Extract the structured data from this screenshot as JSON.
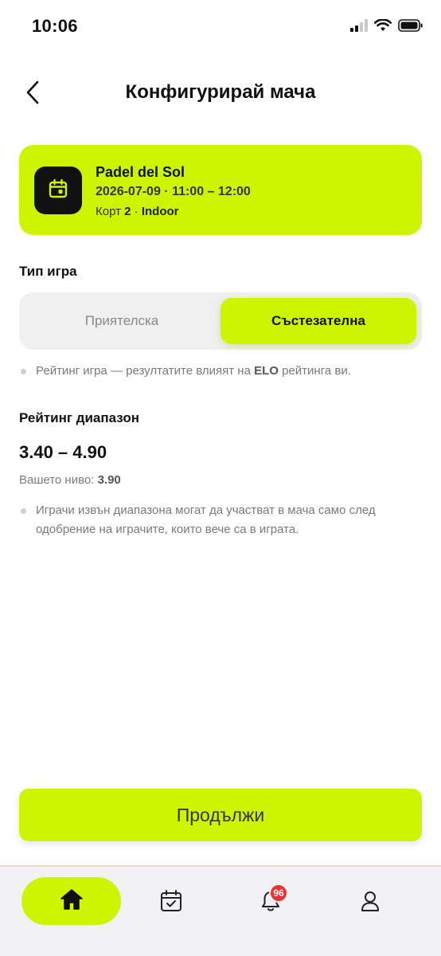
{
  "status_bar": {
    "time": "10:06"
  },
  "header": {
    "title": "Конфигурирай мача",
    "back_icon": "chevron-left-icon"
  },
  "booking": {
    "icon": "calendar-icon",
    "venue": "Padel del Sol",
    "datetime": "2026-07-09 · 11:00 – 12:00",
    "court_prefix": "Корт ",
    "court_number": "2",
    "court_sep": " · ",
    "court_type": "Indoor"
  },
  "game_type": {
    "label": "Тип игра",
    "options": [
      "Приятелска",
      "Състезателна"
    ],
    "selected": "Състезателна",
    "info_prefix": "Рейтинг игра — резултатите влияят на ",
    "info_bold": "ELO",
    "info_suffix": " рейтинга ви."
  },
  "rating": {
    "label": "Рейтинг диапазон",
    "range": "3.40 – 4.90",
    "level_prefix": "Вашето ниво: ",
    "level_value": "3.90",
    "info_line1": "Играчи извън диапазона могат да участват в мача само след",
    "info_line2": "одобрение на играчите, които вече са в играта."
  },
  "continue_button": {
    "label": "Продължи"
  },
  "tab_bar": {
    "items": [
      "home-icon",
      "calendar-check-icon",
      "bell-icon",
      "user-icon"
    ],
    "notifications_count": "96"
  },
  "colors": {
    "accent": "#cdf500",
    "badge": "#ef3030",
    "dark": "#111111"
  }
}
